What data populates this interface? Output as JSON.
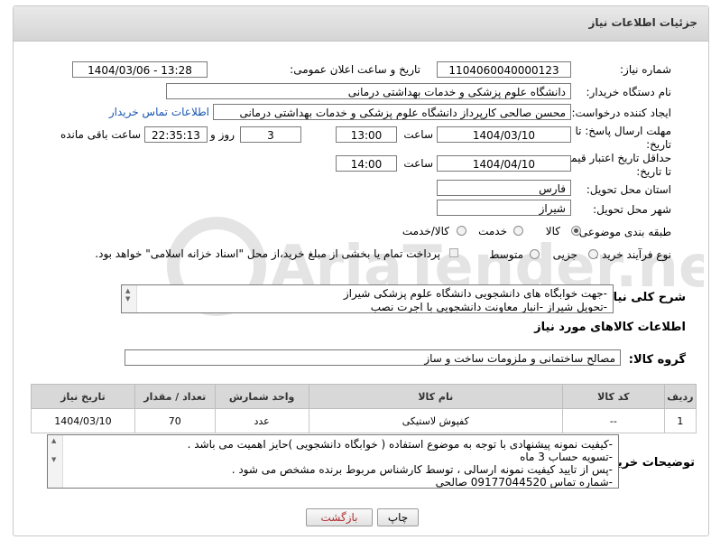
{
  "header": {
    "title": "جزئیات اطلاعات نیاز"
  },
  "form": {
    "need_number_label": "شماره نیاز:",
    "need_number": "1104060040000123",
    "announce_label": "تاریخ و ساعت اعلان عمومی:",
    "announce_value": "1404/03/06 - 13:28",
    "buyer_org_label": "نام دستگاه خریدار:",
    "buyer_org": "دانشگاه علوم پزشکی و خدمات بهداشتی درمانی",
    "requester_label": "ایجاد کننده درخواست:",
    "requester": "محسن صالحی کارپرداز دانشگاه علوم پزشکی و خدمات بهداشتی درمانی",
    "contact_link": "اطلاعات تماس خریدار",
    "deadline_label_1": "مهلت ارسال پاسخ: تا",
    "deadline_label_2": "تاریخ:",
    "deadline_date": "1404/03/10",
    "time_label": "ساعت",
    "deadline_time": "13:00",
    "days_value": "3",
    "days_label": "روز و",
    "remaining_time": "22:35:13",
    "remaining_label": "ساعت باقی مانده",
    "validity_label_1": "حداقل تاریخ اعتبار قیمت:",
    "validity_label_2": "تا تاریخ:",
    "validity_date": "1404/04/10",
    "validity_time": "14:00",
    "province_label": "استان محل تحویل:",
    "province": "فارس",
    "city_label": "شهر محل تحویل:",
    "city": "شیراز",
    "category_label": "طبقه بندی موضوعی:",
    "category_options": [
      "کالا",
      "خدمت",
      "کالا/خدمت"
    ],
    "process_label": "نوع فرآیند خرید :",
    "process_options": [
      "جزیی",
      "متوسط"
    ],
    "payment_note": "پرداخت تمام یا بخشی از مبلغ خرید،از محل \"اسناد خزانه اسلامی\" خواهد بود."
  },
  "summary": {
    "label": "شرح کلی نیاز:",
    "lines": [
      "-جهت خوابگاه های دانشجویی دانشگاه علوم پزشکی شیراز",
      "-تحویل شیراز -انبار معاونت دانشجویی  با اجرت نصب"
    ]
  },
  "goods": {
    "section_title": "اطلاعات کالاهای مورد نیاز",
    "group_label": "گروه کالا:",
    "group_value": "مصالح ساختمانی و ملزومات ساخت و ساز",
    "columns": [
      "ردیف",
      "کد کالا",
      "نام کالا",
      "واحد شمارش",
      "تعداد / مقدار",
      "تاریخ نیاز"
    ],
    "rows": [
      {
        "row": "1",
        "code": "--",
        "name": "کفپوش لاستیکی",
        "unit": "عدد",
        "qty": "70",
        "date": "1404/03/10"
      }
    ]
  },
  "notes": {
    "label": "توضیحات خریدار:",
    "lines": [
      "-کیفیت نمونه پیشنهادی با توجه به موضوع استفاده ( خوابگاه دانشجویی )حایز اهمیت می باشد .",
      "-تسویه حساب 3 ماه",
      "-پس از تایید کیفیت نمونه ارسالی ، توسط کارشناس مربوط برنده مشخص می شود .",
      "-شماره تماس 09177044520 صالحی"
    ]
  },
  "buttons": {
    "print": "چاپ",
    "back": "بازگشت"
  },
  "watermark": {
    "text": "AriaTender.neT"
  },
  "colors": {
    "link": "#1a55b0",
    "back_button_text": "#b03030"
  }
}
